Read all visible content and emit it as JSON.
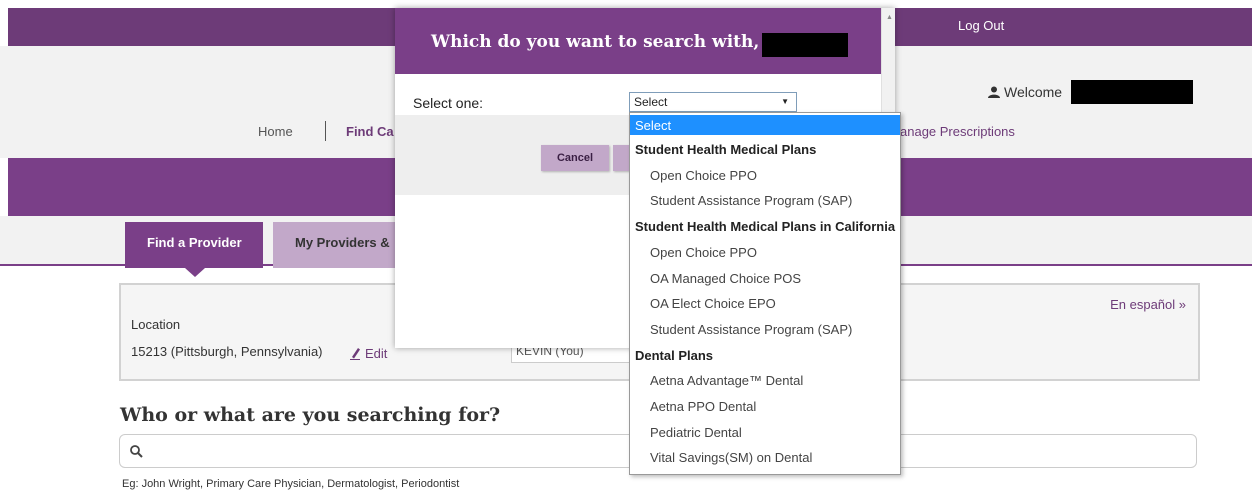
{
  "header": {
    "logout_label": "Log Out",
    "welcome_label": "Welcome"
  },
  "nav": {
    "home_label": "Home",
    "findcare_label": "Find Ca",
    "manage_label": "anage Prescriptions"
  },
  "tabs": {
    "find_provider": "Find a Provider",
    "my_providers": "My Providers & "
  },
  "location": {
    "label": "Location",
    "value": "15213 (Pittsburgh, Pennsylvania)",
    "edit_label": "Edit",
    "member_value": "KEVIN (You)",
    "espanol_label": "En español »"
  },
  "search": {
    "title": "Who or what are you searching for?",
    "hint": "Eg: John Wright, Primary Care Physician, Dermatologist, Periodontist"
  },
  "modal": {
    "title": "Which do you want to search with,",
    "select_label": "Select one:",
    "select_value": "Select",
    "cancel_label": "Cancel"
  },
  "dropdown": {
    "items": [
      {
        "type": "selected",
        "label": "Select"
      },
      {
        "type": "group",
        "label": "Student Health Medical Plans"
      },
      {
        "type": "option",
        "label": "Open Choice PPO"
      },
      {
        "type": "option",
        "label": "Student Assistance Program (SAP)"
      },
      {
        "type": "group",
        "label": "Student Health Medical Plans in California"
      },
      {
        "type": "option",
        "label": "Open Choice PPO"
      },
      {
        "type": "option",
        "label": "OA Managed Choice POS"
      },
      {
        "type": "option",
        "label": "OA Elect Choice EPO"
      },
      {
        "type": "option",
        "label": "Student Assistance Program (SAP)"
      },
      {
        "type": "group",
        "label": "Dental Plans"
      },
      {
        "type": "option",
        "label": "Aetna Advantage™ Dental"
      },
      {
        "type": "option",
        "label": "Aetna PPO Dental"
      },
      {
        "type": "option",
        "label": "Pediatric Dental"
      },
      {
        "type": "option",
        "label": "Vital Savings(SM) on Dental"
      }
    ]
  },
  "colors": {
    "brand_purple": "#7a3f88",
    "light_purple": "#c2a8c9",
    "selection_blue": "#1e90ff"
  }
}
